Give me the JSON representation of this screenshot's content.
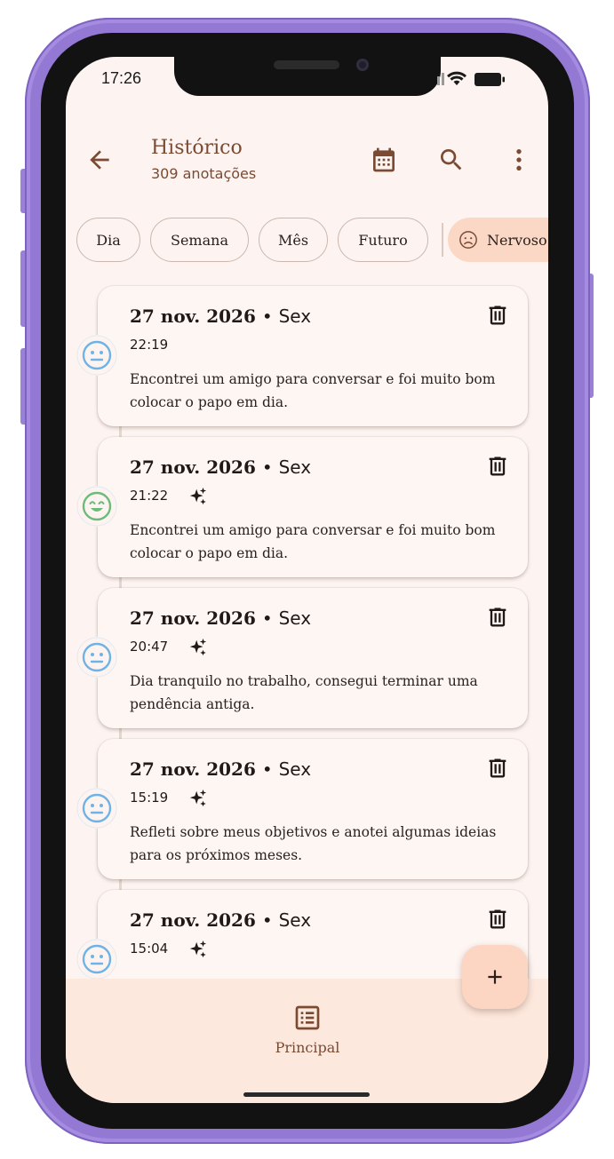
{
  "status_bar": {
    "time": "17:26"
  },
  "app_bar": {
    "title": "Histórico",
    "subtitle": "309 anotações",
    "icons": [
      "arrow-back-icon",
      "calendar-icon",
      "search-icon",
      "more-vert-icon"
    ]
  },
  "filters": {
    "chips": [
      "Dia",
      "Semana",
      "Mês",
      "Futuro"
    ],
    "mood_chip": {
      "label": "Nervoso",
      "icon": "nervous-face-icon"
    }
  },
  "entries": [
    {
      "date": "27 nov. 2026",
      "separator": "•",
      "weekday": "Sex",
      "time": "22:19",
      "ai_generated": false,
      "mood": "neutral",
      "text": "Encontrei um amigo para conversar e foi muito bom colocar o papo em dia."
    },
    {
      "date": "27 nov. 2026",
      "separator": "•",
      "weekday": "Sex",
      "time": "21:22",
      "ai_generated": true,
      "mood": "happy",
      "text": "Encontrei um amigo para conversar e foi muito bom colocar o papo em dia."
    },
    {
      "date": "27 nov. 2026",
      "separator": "•",
      "weekday": "Sex",
      "time": "20:47",
      "ai_generated": true,
      "mood": "neutral",
      "text": "Dia tranquilo no trabalho, consegui terminar uma pendência antiga."
    },
    {
      "date": "27 nov. 2026",
      "separator": "•",
      "weekday": "Sex",
      "time": "15:19",
      "ai_generated": true,
      "mood": "neutral",
      "text": "Refleti sobre meus objetivos e anotei algumas ideias para os próximos meses."
    },
    {
      "date": "27 nov. 2026",
      "separator": "•",
      "weekday": "Sex",
      "time": "15:04",
      "ai_generated": true,
      "mood": "neutral",
      "text": ""
    }
  ],
  "fab": {
    "icon": "add-icon"
  },
  "bottom_nav": {
    "label": "Principal",
    "icon": "list-icon"
  },
  "colors": {
    "background": "#fdf4f1",
    "accent_brown": "#7a4a33",
    "mood_neutral": "#6fb3e6",
    "mood_happy": "#6dbb7a",
    "fab": "#fcd6c3",
    "nav_background": "#fde8dd",
    "frame": "#9379d3"
  }
}
